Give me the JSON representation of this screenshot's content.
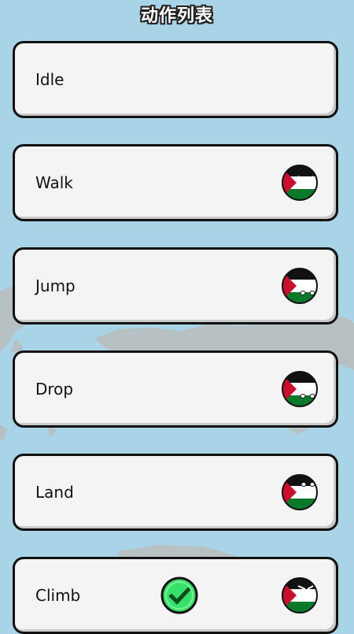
{
  "header": {
    "title": "动作列表"
  },
  "actions": [
    {
      "label": "Idle",
      "icon": "none"
    },
    {
      "label": "Walk",
      "icon": "palestine-ball-icon"
    },
    {
      "label": "Jump",
      "icon": "palestine-ball-icon"
    },
    {
      "label": "Drop",
      "icon": "palestine-ball-icon"
    },
    {
      "label": "Land",
      "icon": "palestine-ball-icon"
    },
    {
      "label": "Climb",
      "icon": "palestine-ball-icon",
      "selected": true
    }
  ],
  "colors": {
    "background": "#a9d3e6",
    "card": "#f4f4f4",
    "card_border": "#111111",
    "land": "#b7c0c3",
    "check_green": "#37e06a"
  }
}
